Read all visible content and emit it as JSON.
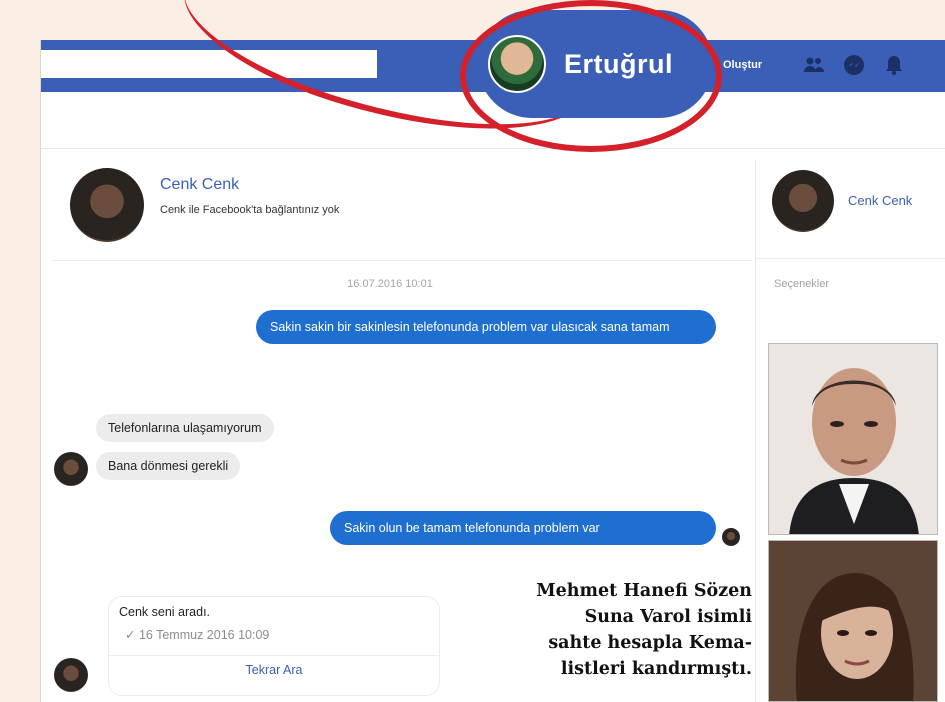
{
  "search": {
    "value": "",
    "placeholder": ""
  },
  "nav": {
    "profile_name": "Ertuğrul",
    "create_label": "Oluştur",
    "icons": [
      "friends-icon",
      "messenger-icon",
      "notifications-icon"
    ]
  },
  "conversation": {
    "contact_name": "Cenk Cenk",
    "connection_status": "Cenk ile Facebook'ta bağlantınız yok",
    "timestamp": "16.07.2016 10:01",
    "messages": [
      {
        "direction": "outgoing",
        "text": "Sakin sakin bir sakinlesin telefonunda problem var ulasıcak sana tamam"
      },
      {
        "direction": "incoming",
        "text": "Telefonlarına ulaşamıyorum"
      },
      {
        "direction": "incoming",
        "text": "Bana dönmesi gerekli"
      },
      {
        "direction": "outgoing",
        "text": "Sakin olun be tamam telefonunda problem var"
      }
    ],
    "call": {
      "title": "Cenk seni aradı.",
      "time": "✓ 16 Temmuz 2016 10:09",
      "action": "Tekrar Ara"
    }
  },
  "right_panel": {
    "contact_name": "Cenk Cenk",
    "options_label": "Seçenekler"
  },
  "caption": {
    "lines": [
      "Mehmet Hanefi Sözen",
      "Suna Varol isimli",
      "sahte hesapla Kema-",
      "listleri kandırmıştı."
    ]
  },
  "colors": {
    "facebook_blue": "#3b5fb6",
    "bubble_blue": "#1f6fd1",
    "highlight_red": "#d4202a"
  }
}
